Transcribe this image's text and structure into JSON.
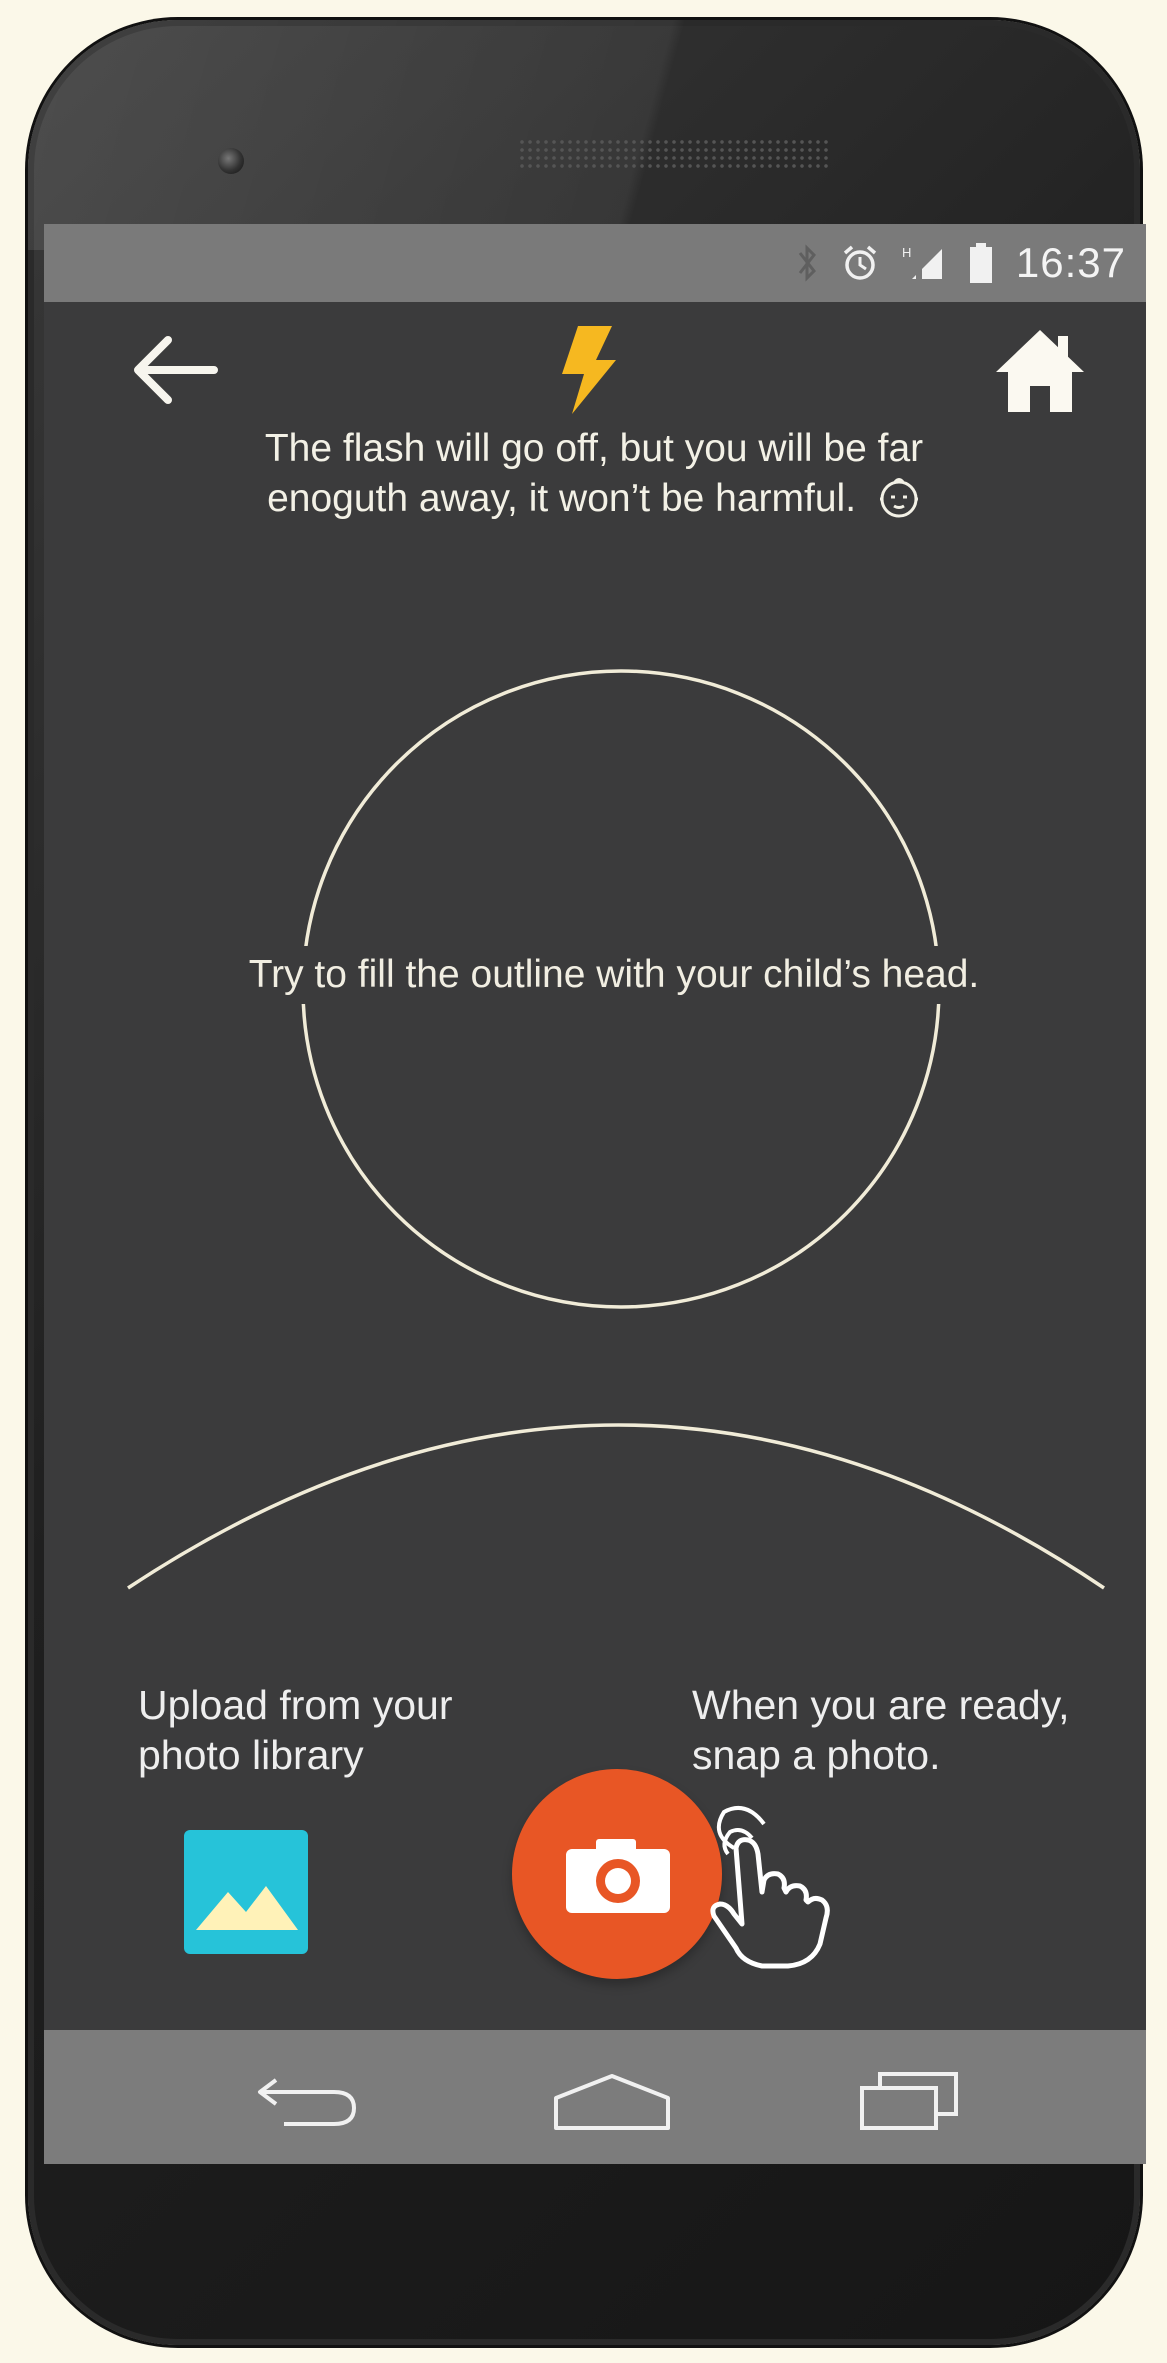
{
  "status_bar": {
    "time": "16:37",
    "icons": [
      "bluetooth-icon",
      "alarm-icon",
      "signal-icon",
      "battery-icon"
    ]
  },
  "top_bar": {
    "icons": [
      "back-arrow-icon",
      "flash-icon",
      "home-icon"
    ]
  },
  "flash_note": {
    "line1": "The flash will go off,  but you will be far",
    "line2": "enoguth away, it won’t be harmful.",
    "icon": "baby-face-icon"
  },
  "outline": {
    "hint": "Try to fill the outline with your child’s head."
  },
  "actions": {
    "upload_line1": "Upload from your",
    "upload_line2": "photo library",
    "snap_line1": "When you are ready,",
    "snap_line2": "snap a photo.",
    "gallery_icon": "image-gallery-icon",
    "camera_icon": "camera-icon",
    "hand_icon": "tap-hand-icon"
  },
  "nav_bar": {
    "icons": [
      "nav-back-icon",
      "nav-home-icon",
      "nav-recent-apps-icon"
    ]
  },
  "colors": {
    "background": "#fbf8e9",
    "screen": "#3b3b3c",
    "bars": "#7a7a7a",
    "flash": "#f6b820",
    "camera_button": "#e85625",
    "gallery_tile": "#26c3d9",
    "outline_stroke": "#f1ecd8"
  }
}
